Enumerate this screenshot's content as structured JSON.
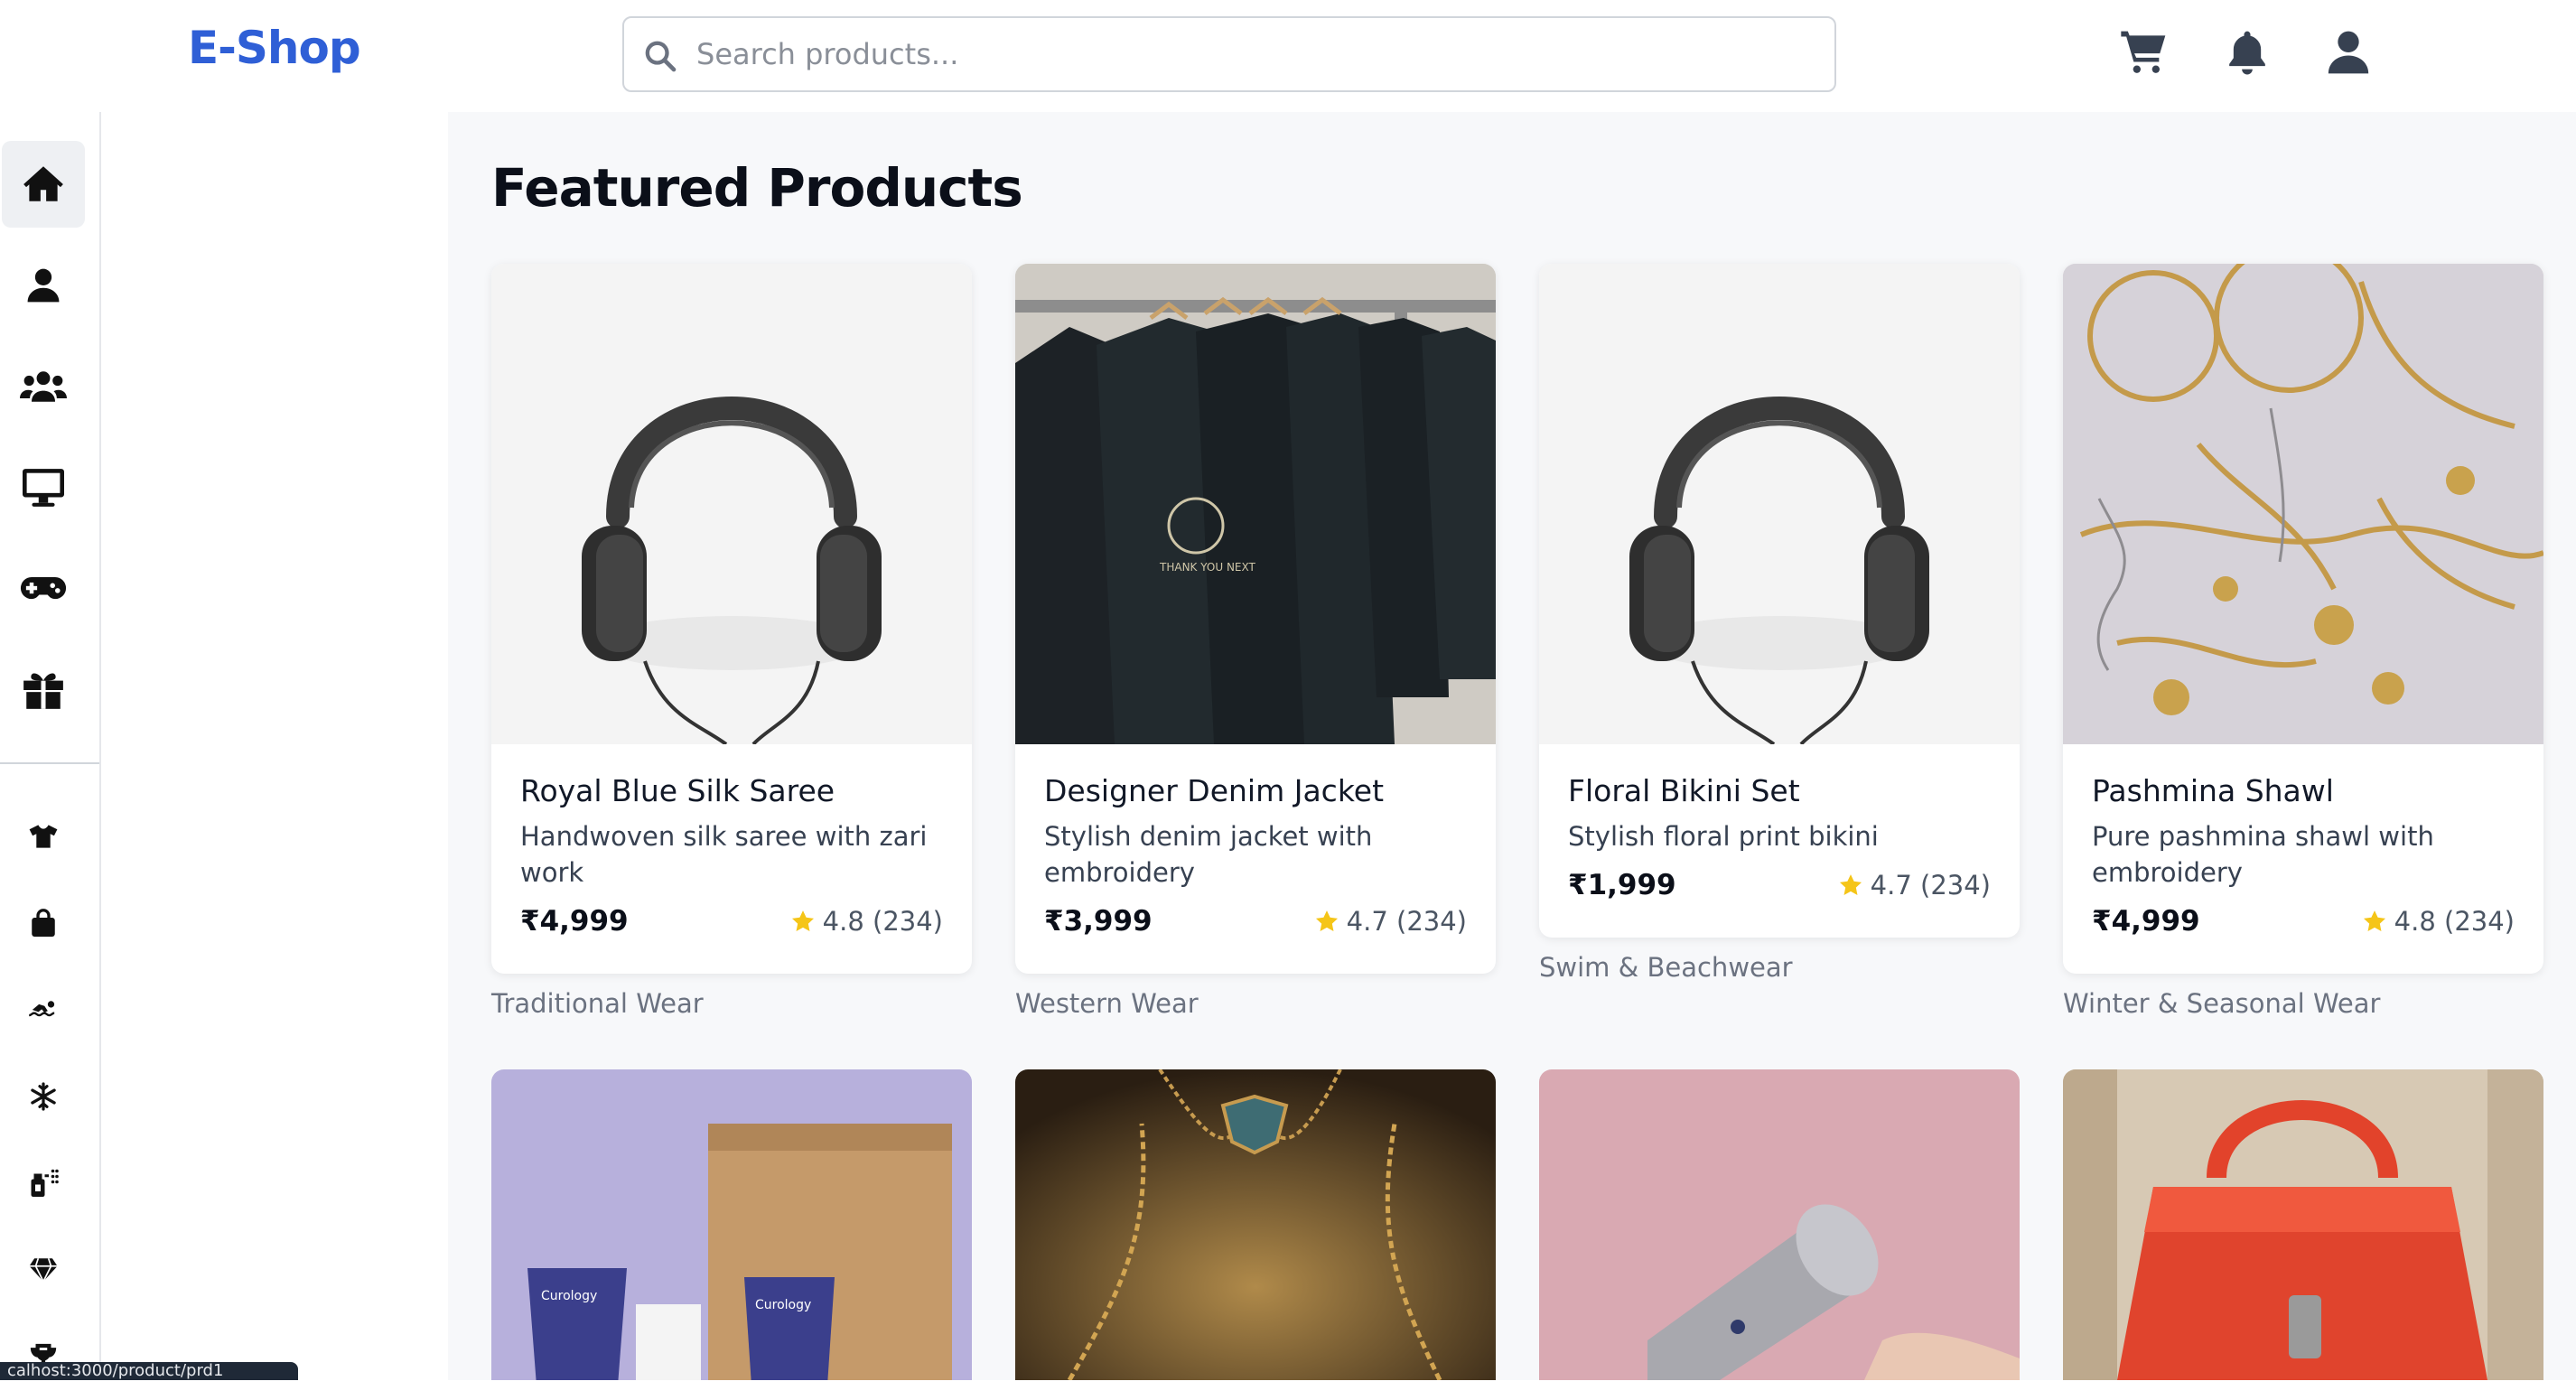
{
  "header": {
    "logo": "E-Shop",
    "search_placeholder": "Search products...",
    "icons": [
      "cart-icon",
      "bell-icon",
      "user-icon"
    ]
  },
  "sidebar": {
    "items": [
      {
        "icon": "home-icon",
        "active": true
      },
      {
        "icon": "user-icon"
      },
      {
        "icon": "users-icon"
      },
      {
        "icon": "monitor-icon"
      },
      {
        "icon": "gamepad-icon"
      },
      {
        "icon": "gift-icon"
      },
      {
        "icon": "tshirt-icon"
      },
      {
        "icon": "shopping-bag-icon"
      },
      {
        "icon": "swimmer-icon"
      },
      {
        "icon": "snowflake-icon"
      },
      {
        "icon": "spray-bottle-icon"
      },
      {
        "icon": "gem-icon"
      },
      {
        "icon": "trophy-icon"
      }
    ]
  },
  "main": {
    "title": "Featured Products",
    "products": [
      {
        "name": "Royal Blue Silk Saree",
        "description": "Handwoven silk saree with zari work",
        "price": "₹4,999",
        "rating": "4.8",
        "reviews": "(234)",
        "category": "Traditional Wear",
        "image": "headphones"
      },
      {
        "name": "Designer Denim Jacket",
        "description": "Stylish denim jacket with embroidery",
        "price": "₹3,999",
        "rating": "4.7",
        "reviews": "(234)",
        "category": "Western Wear",
        "image": "tshirts"
      },
      {
        "name": "Floral Bikini Set",
        "description": "Stylish floral print bikini",
        "price": "₹1,999",
        "rating": "4.7",
        "reviews": "(234)",
        "category": "Swim & Beachwear",
        "image": "headphones"
      },
      {
        "name": "Pashmina Shawl",
        "description": "Pure pashmina shawl with embroidery",
        "price": "₹4,999",
        "rating": "4.8",
        "reviews": "(234)",
        "category": "Winter & Seasonal Wear",
        "image": "jewelry"
      }
    ],
    "second_row_images": [
      "skincare",
      "necklace",
      "hairdryer",
      "handbag"
    ]
  },
  "statusbar": {
    "url": "calhost:3000/product/prd1"
  },
  "colors": {
    "brand": "#2f5fd6",
    "star": "#f5c518",
    "background": "#f7f8fa"
  }
}
